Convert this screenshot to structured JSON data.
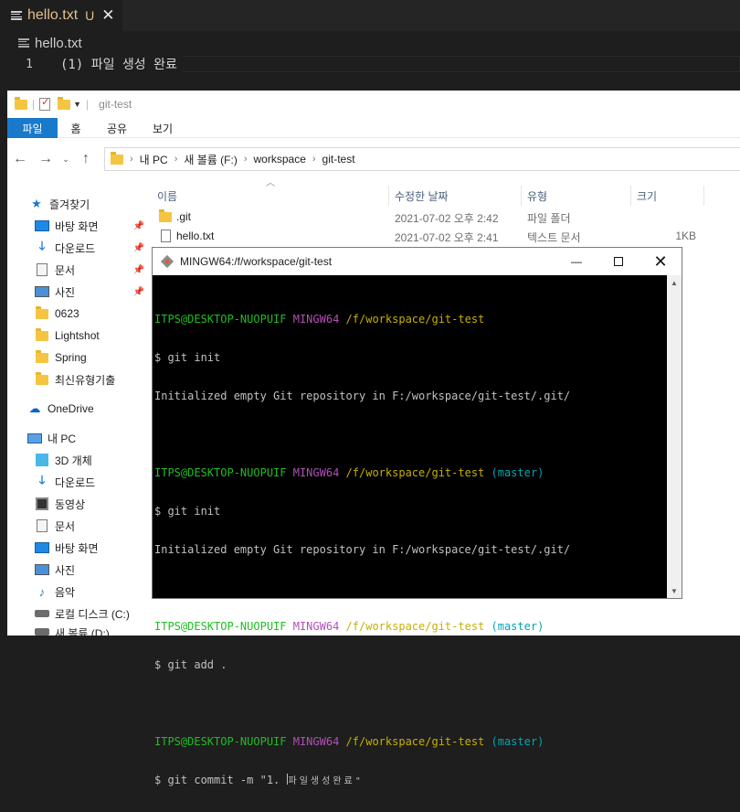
{
  "vscode": {
    "tab_name": "hello.txt",
    "tab_badge": "U",
    "close_glyph": "✕",
    "breadcrumb_file": "hello.txt",
    "line_number": "1",
    "line_text": "(1) 파일 생성 완료"
  },
  "explorer": {
    "window_title": "git-test",
    "ribbon_tabs": [
      "파일",
      "홈",
      "공유",
      "보기"
    ],
    "address": [
      "내 PC",
      "새 볼륨 (F:)",
      "workspace",
      "git-test"
    ],
    "columns": {
      "name": "이름",
      "date": "수정한 날짜",
      "type": "유형",
      "size": "크기"
    },
    "files": [
      {
        "name": ".git",
        "date": "2021-07-02 오후 2:42",
        "type": "파일 폴더",
        "size": ""
      },
      {
        "name": "hello.txt",
        "date": "2021-07-02 오후 2:41",
        "type": "텍스트 문서",
        "size": "1KB"
      }
    ],
    "nav": {
      "quick_access": "즐겨찾기",
      "quick_items": [
        "바탕 화면",
        "다운로드",
        "문서",
        "사진",
        "0623",
        "Lightshot",
        "Spring",
        "최신유형기출"
      ],
      "onedrive": "OneDrive",
      "this_pc": "내 PC",
      "pc_items": [
        "3D 개체",
        "다운로드",
        "동영상",
        "문서",
        "바탕 화면",
        "사진",
        "음악",
        "로컬 디스크 (C:)",
        "새 볼륨 (D:)"
      ]
    }
  },
  "terminal": {
    "title": "MINGW64:/f/workspace/git-test",
    "prompt_user": "ITPS@DESKTOP-NUOPUIF",
    "prompt_sys": "MINGW64",
    "prompt_path": "/f/workspace/git-test",
    "branch": "(master)",
    "cmd1": "$ git init",
    "out1": "Initialized empty Git repository in F:/workspace/git-test/.git/",
    "cmd2": "$ git init",
    "out2": "Initialized empty Git repository in F:/workspace/git-test/.git/",
    "cmd3": "$ git add .",
    "cmd4_prefix": "$ git commit -m \"1. ",
    "cmd4_suffix": "파일생성완료\""
  },
  "colors": {
    "vscode_bg": "#1e1e1e",
    "vscode_modified": "#e2c08d",
    "explorer_accent": "#1979ca",
    "bash_green": "#1fbd23",
    "bash_magenta": "#b24fb5",
    "bash_yellow": "#c6b000",
    "bash_cyan": "#00a6b3"
  }
}
